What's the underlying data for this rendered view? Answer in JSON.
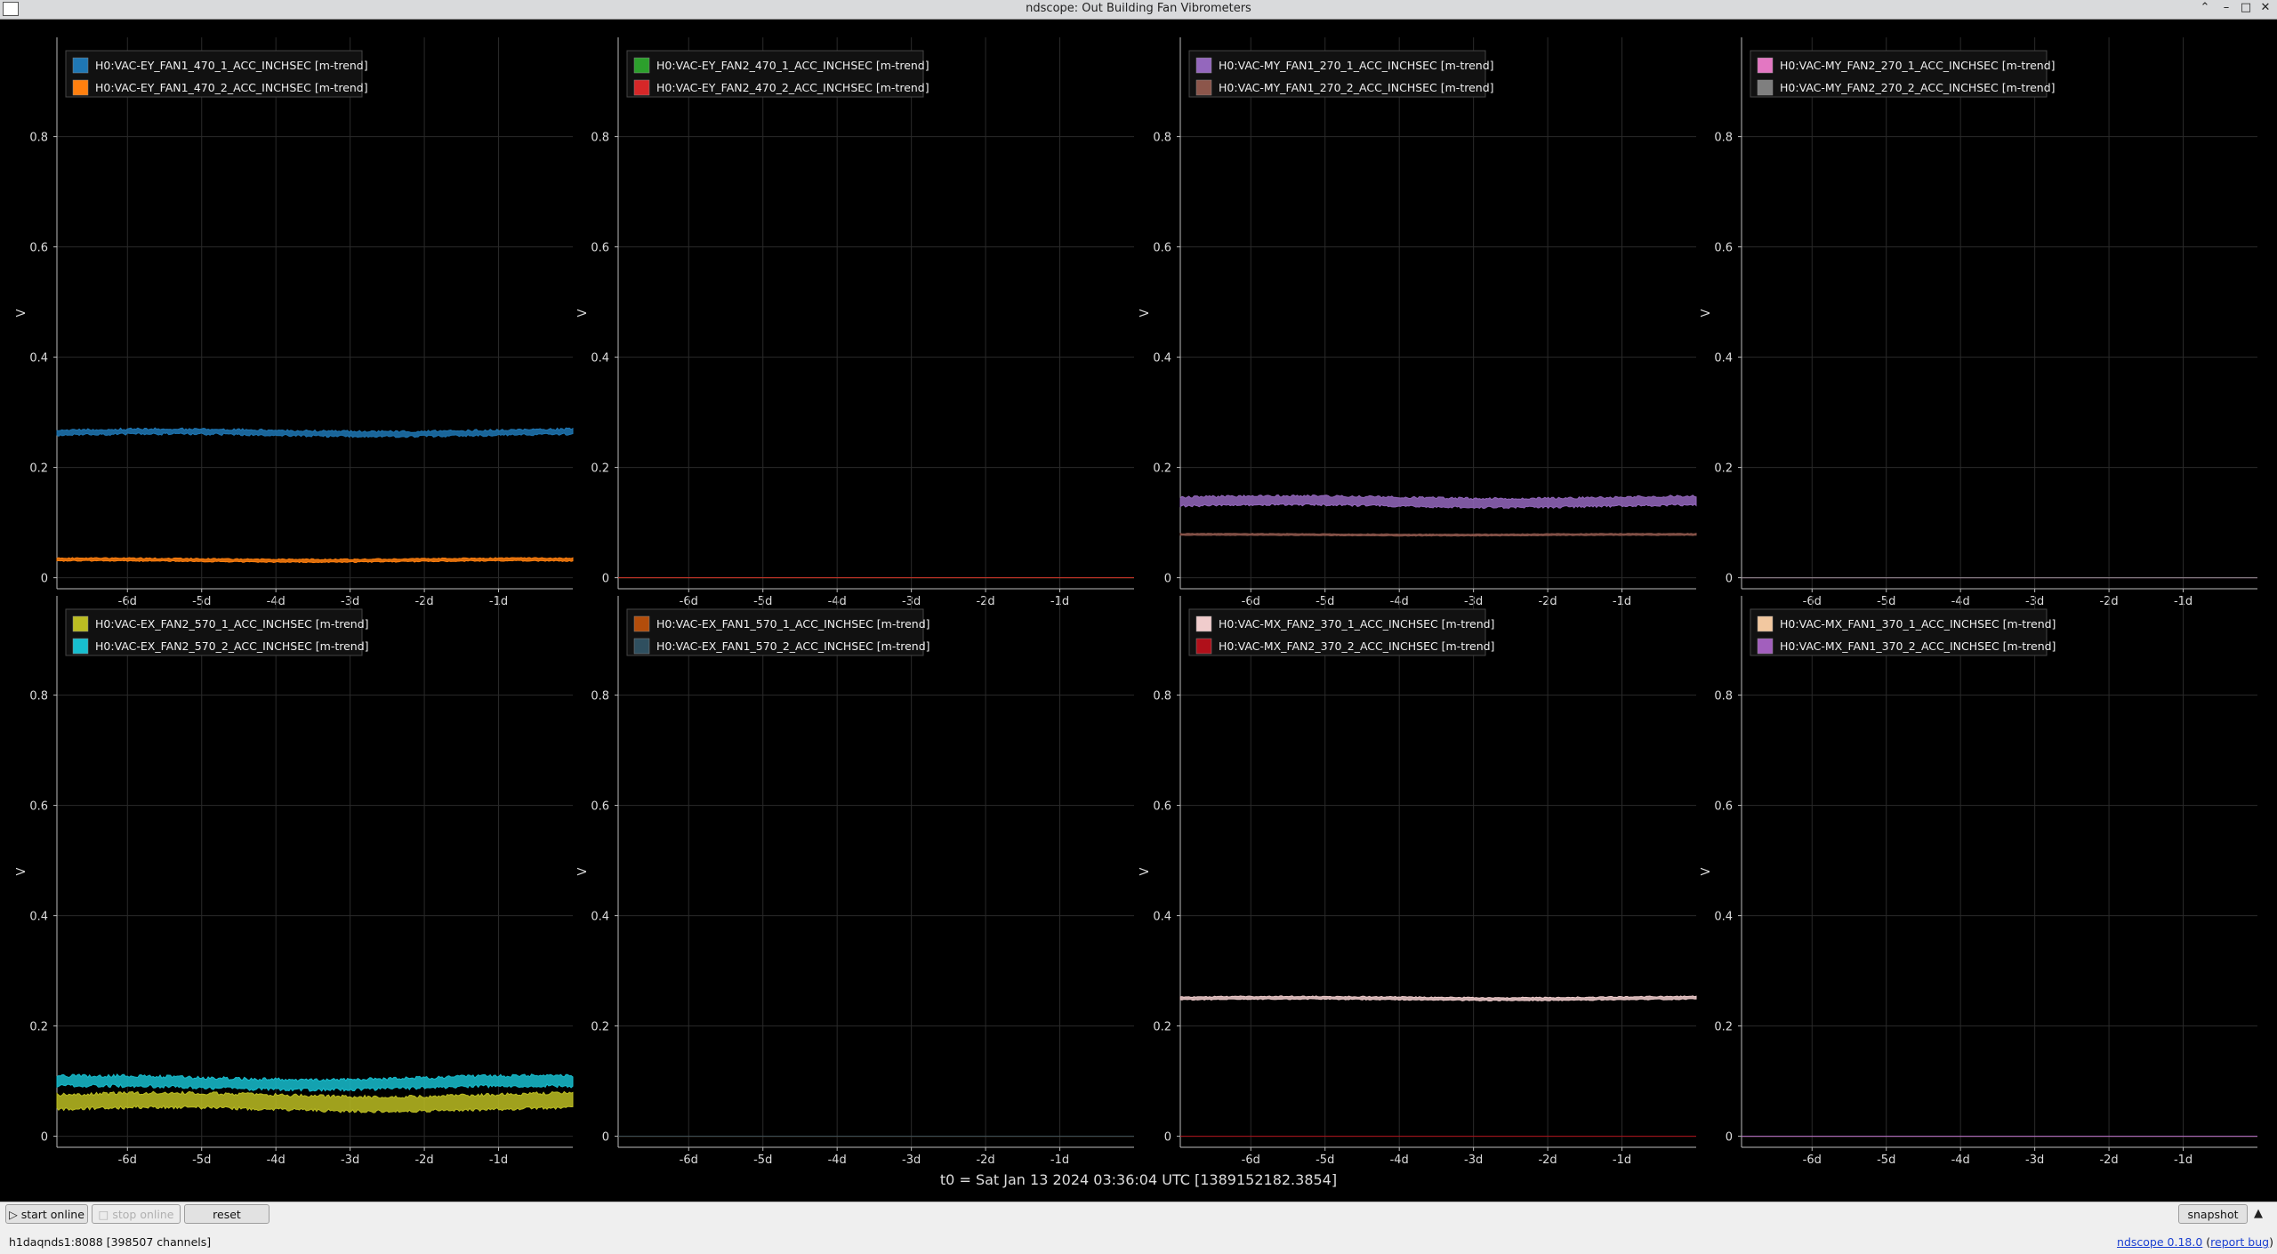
{
  "window": {
    "title": "ndscope: Out Building Fan Vibrometers"
  },
  "panels": [
    {
      "row": 0,
      "col": 0,
      "channels": [
        {
          "name": "H0:VAC-EY_FAN1_470_1_ACC_INCHSEC [m-trend]",
          "color": "#1f77b4",
          "level": 0.263,
          "band": 0.005,
          "noise": 0.004
        },
        {
          "name": "H0:VAC-EY_FAN1_470_2_ACC_INCHSEC [m-trend]",
          "color": "#ff7f0e",
          "level": 0.032,
          "band": 0.003,
          "noise": 0.002
        }
      ]
    },
    {
      "row": 0,
      "col": 1,
      "channels": [
        {
          "name": "H0:VAC-EY_FAN2_470_1_ACC_INCHSEC [m-trend]",
          "color": "#2ca02c",
          "level": 0.0,
          "band": 0,
          "noise": 0
        },
        {
          "name": "H0:VAC-EY_FAN2_470_2_ACC_INCHSEC [m-trend]",
          "color": "#d62728",
          "level": 0.0,
          "band": 0,
          "noise": 0
        }
      ]
    },
    {
      "row": 0,
      "col": 2,
      "channels": [
        {
          "name": "H0:VAC-MY_FAN1_270_1_ACC_INCHSEC [m-trend]",
          "color": "#9467bd",
          "level": 0.138,
          "band": 0.012,
          "noise": 0.004
        },
        {
          "name": "H0:VAC-MY_FAN1_270_2_ACC_INCHSEC [m-trend]",
          "color": "#8c564b",
          "level": 0.078,
          "band": 0.002,
          "noise": 0.001
        }
      ]
    },
    {
      "row": 0,
      "col": 3,
      "channels": [
        {
          "name": "H0:VAC-MY_FAN2_270_1_ACC_INCHSEC [m-trend]",
          "color": "#e377c2",
          "level": 0.0,
          "band": 0,
          "noise": 0
        },
        {
          "name": "H0:VAC-MY_FAN2_270_2_ACC_INCHSEC [m-trend]",
          "color": "#7f7f7f",
          "level": 0.0,
          "band": 0,
          "noise": 0
        }
      ]
    },
    {
      "row": 1,
      "col": 0,
      "channels": [
        {
          "name": "H0:VAC-EX_FAN2_570_1_ACC_INCHSEC [m-trend]",
          "color": "#bcbd22",
          "level": 0.062,
          "band": 0.02,
          "noise": 0.006
        },
        {
          "name": "H0:VAC-EX_FAN2_570_2_ACC_INCHSEC [m-trend]",
          "color": "#17becf",
          "level": 0.097,
          "band": 0.012,
          "noise": 0.006
        }
      ]
    },
    {
      "row": 1,
      "col": 1,
      "channels": [
        {
          "name": "H0:VAC-EX_FAN1_570_1_ACC_INCHSEC [m-trend]",
          "color": "#b34d0b",
          "level": 0.0,
          "band": 0,
          "noise": 0
        },
        {
          "name": "H0:VAC-EX_FAN1_570_2_ACC_INCHSEC [m-trend]",
          "color": "#2f4f5f",
          "level": 0.0,
          "band": 0,
          "noise": 0
        }
      ]
    },
    {
      "row": 1,
      "col": 2,
      "channels": [
        {
          "name": "H0:VAC-MX_FAN2_370_1_ACC_INCHSEC [m-trend]",
          "color": "#f0cccc",
          "level": 0.25,
          "band": 0.003,
          "noise": 0.002
        },
        {
          "name": "H0:VAC-MX_FAN2_370_2_ACC_INCHSEC [m-trend]",
          "color": "#b0101a",
          "level": 0.0,
          "band": 0,
          "noise": 0
        }
      ]
    },
    {
      "row": 1,
      "col": 3,
      "channels": [
        {
          "name": "H0:VAC-MX_FAN1_370_1_ACC_INCHSEC [m-trend]",
          "color": "#f2c8a0",
          "level": 0.0,
          "band": 0,
          "noise": 0
        },
        {
          "name": "H0:VAC-MX_FAN1_370_2_ACC_INCHSEC [m-trend]",
          "color": "#a25fbd",
          "level": 0.0,
          "band": 0,
          "noise": 0
        }
      ]
    }
  ],
  "axes": {
    "ylabel": "V",
    "yticks": [
      "0",
      "0.2",
      "0.4",
      "0.6",
      "0.8"
    ],
    "yticks_values": [
      0,
      0.2,
      0.4,
      0.6,
      0.8
    ],
    "ylim": [
      -0.02,
      0.98
    ],
    "xticks": [
      "-6d",
      "-5d",
      "-4d",
      "-3d",
      "-2d",
      "-1d"
    ],
    "xticks_values": [
      -6,
      -5,
      -4,
      -3,
      -2,
      -1
    ],
    "xlim": [
      -6.95,
      0
    ]
  },
  "t0_label": "t0 = Sat Jan 13 2024 03:36:04 UTC [1389152182.3854]",
  "toolbar": {
    "start_online": "start online",
    "stop_online": "stop online",
    "reset": "reset",
    "snapshot": "snapshot"
  },
  "status": {
    "server": "h1daqnds1:8088  [398507 channels]"
  },
  "footer": {
    "version": "ndscope 0.18.0",
    "open_paren": " (",
    "report_bug": "report bug",
    "close_paren": ")"
  },
  "colors": {
    "background": "#000000",
    "grid": "#2a2a2a",
    "text": "#dddddd",
    "legend_bg": "#111111"
  }
}
